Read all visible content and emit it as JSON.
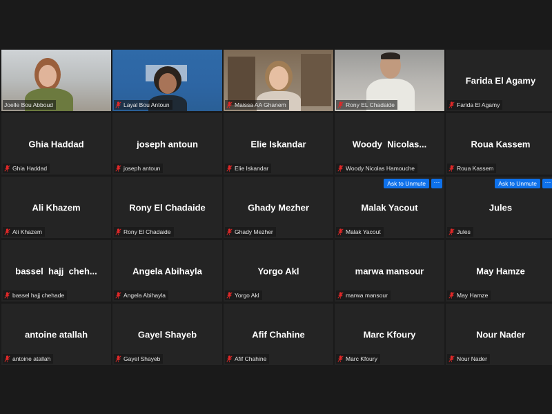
{
  "colors": {
    "background": "#1a1a1a",
    "tile": "#242424",
    "active_speaker_border": "#c6d93b",
    "muted_mic": "#e02828",
    "accent_button": "#0e71eb"
  },
  "participants": [
    {
      "name": "Joelle Bou Abboud",
      "display": "",
      "video": true
    },
    {
      "name": "Layal Bou Antoun",
      "display": "",
      "video": true
    },
    {
      "name": "Maissa AA Ghanem",
      "display": "",
      "video": true
    },
    {
      "name": "Rony EL Chadaide",
      "display": "",
      "video": true
    },
    {
      "name": "Farida El Agamy",
      "display": "Farida El Agamy",
      "video": false
    },
    {
      "name": "Ghia Haddad",
      "display": "Ghia Haddad",
      "video": false
    },
    {
      "name": "joseph antoun",
      "display": "joseph antoun",
      "video": false
    },
    {
      "name": "Elie Iskandar",
      "display": "Elie Iskandar",
      "video": false
    },
    {
      "name": "Woody Nicolas Hamouche",
      "display": "Woody  Nicolas...",
      "video": false
    },
    {
      "name": "Roua Kassem",
      "display": "Roua Kassem",
      "video": false
    },
    {
      "name": "Ali Khazem",
      "display": "Ali Khazem",
      "video": false
    },
    {
      "name": "Rony El Chadaide",
      "display": "Rony El Chadaide",
      "video": false
    },
    {
      "name": "Ghady Mezher",
      "display": "Ghady Mezher",
      "video": false
    },
    {
      "name": "Malak Yacout",
      "display": "Malak Yacout",
      "video": false
    },
    {
      "name": "Jules",
      "display": "Jules",
      "video": false
    },
    {
      "name": "bassel hajj chehade",
      "display": "bassel  hajj  cheh...",
      "video": false
    },
    {
      "name": "Angela Abihayla",
      "display": "Angela Abihayla",
      "video": false
    },
    {
      "name": "Yorgo Akl",
      "display": "Yorgo Akl",
      "video": false
    },
    {
      "name": "marwa mansour",
      "display": "marwa mansour",
      "video": false
    },
    {
      "name": "May Hamze",
      "display": "May Hamze",
      "video": false
    },
    {
      "name": "antoine atallah",
      "display": "antoine atallah",
      "video": false
    },
    {
      "name": "Gayel Shayeb",
      "display": "Gayel Shayeb",
      "video": false
    },
    {
      "name": "Afif Chahine",
      "display": "Afif Chahine",
      "video": false
    },
    {
      "name": "Marc Kfoury",
      "display": "Marc Kfoury",
      "video": false
    },
    {
      "name": "Nour Nader",
      "display": "Nour Nader",
      "video": false
    }
  ],
  "actions": {
    "ask_to_unmute_label": "Ask to Unmute",
    "more_label": "···"
  },
  "icons": {
    "muted": "mic-muted-icon",
    "more": "more-icon"
  }
}
